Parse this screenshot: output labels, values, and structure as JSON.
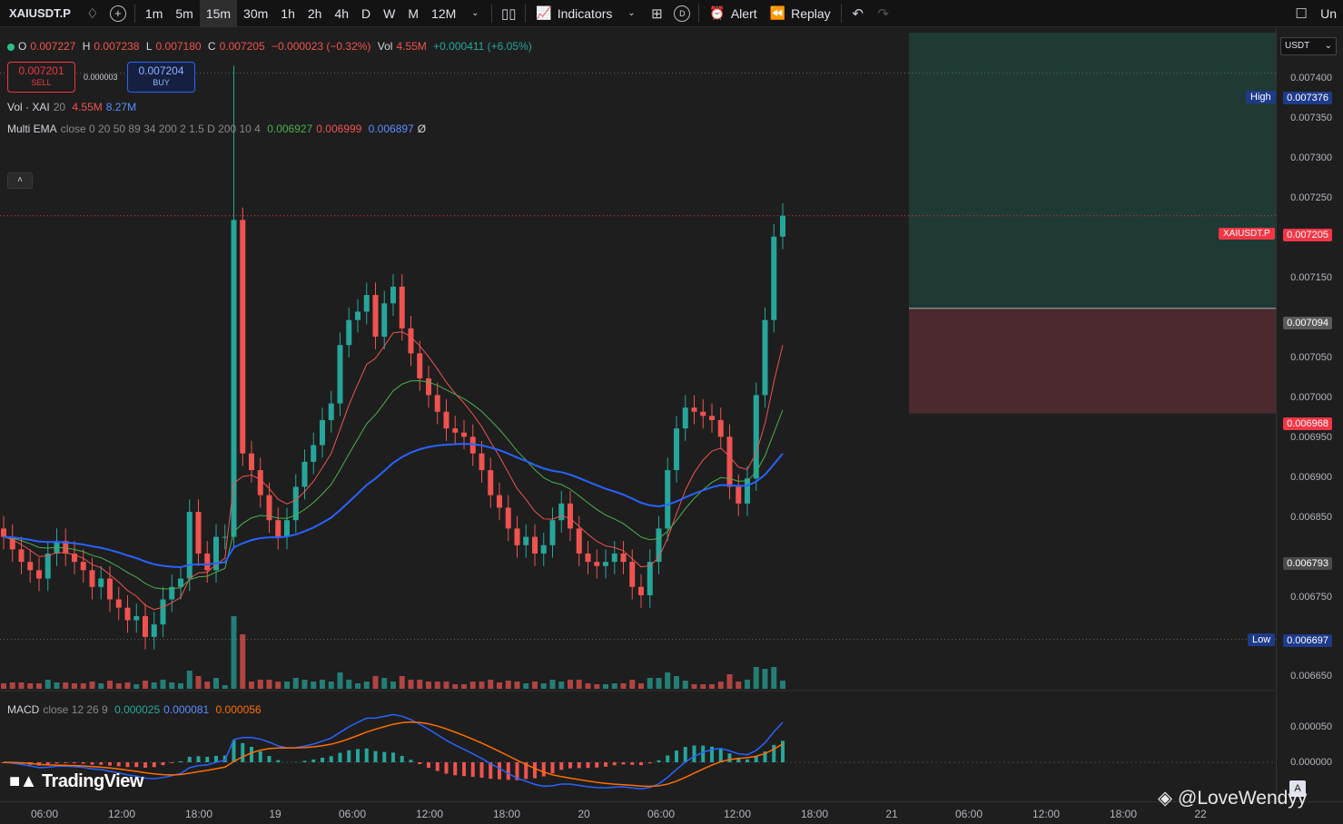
{
  "toolbar": {
    "symbol": "XAIUSDT.P",
    "timeframes": [
      "1m",
      "5m",
      "15m",
      "30m",
      "1h",
      "2h",
      "4h",
      "D",
      "W",
      "M",
      "12M"
    ],
    "active_timeframe": "15m",
    "indicators_label": "Indicators",
    "alert_label": "Alert",
    "replay_label": "Replay",
    "d_badge": "D",
    "right_label": "Un"
  },
  "legend": {
    "o_label": "O",
    "o_value": "0.007227",
    "h_label": "H",
    "h_value": "0.007238",
    "l_label": "L",
    "l_value": "0.007180",
    "c_label": "C",
    "c_value": "0.007205",
    "change": "−0.000023 (−0.32%)",
    "vol_label": "Vol",
    "vol_value": "4.55M",
    "vol_change": "+0.000411 (+6.05%)"
  },
  "trade": {
    "sell_price": "0.007201",
    "sell_label": "SELL",
    "spread": "0.000003",
    "buy_price": "0.007204",
    "buy_label": "BUY"
  },
  "indicators": {
    "vol_title": "Vol · XAI",
    "vol_len": "20",
    "vol_a": "4.55M",
    "vol_b": "8.27M",
    "ema_title": "Multi EMA",
    "ema_params": "close 0 20 50 89 34 200 2 1.5 D 200 10 4",
    "ema_v1": "0.006927",
    "ema_v2": "0.006999",
    "ema_v3": "0.006897",
    "ema_v4": "Ø",
    "macd_title": "MACD",
    "macd_params": "close 12 26 9",
    "macd_v1": "0.000025",
    "macd_v2": "0.000081",
    "macd_v3": "0.000056"
  },
  "price_axis": {
    "unit": "USDT",
    "ticks": [
      "0.007400",
      "0.007350",
      "0.007300",
      "0.007250",
      "0.007150",
      "0.007050",
      "0.007000",
      "0.006950",
      "0.006900",
      "0.006850",
      "0.006750",
      "0.006650"
    ],
    "high_label": "High",
    "high_value": "0.007376",
    "current_symbol": "XAIUSDT.P",
    "current_value": "0.007205",
    "target_value": "0.007094",
    "stop_value": "0.006968",
    "mid_value": "0.006793",
    "low_label": "Low",
    "low_value": "0.006697",
    "macd_ticks": [
      "0.000050",
      "0.000000"
    ]
  },
  "time_axis": [
    "06:00",
    "12:00",
    "18:00",
    "19",
    "06:00",
    "12:00",
    "18:00",
    "20",
    "06:00",
    "12:00",
    "18:00",
    "21",
    "06:00",
    "12:00",
    "18:00",
    "22"
  ],
  "branding": {
    "logo": "TradingView",
    "watermark": "@LoveWendyy",
    "a_button": "A"
  },
  "colors": {
    "up": "#26a69a",
    "down": "#ef5350",
    "ema_fast": "#ef5350",
    "ema_mid": "#4caf50",
    "ema_slow": "#2962ff",
    "macd": "#2962ff",
    "signal": "#ff6d00",
    "profit_zone": "#1f3a35",
    "loss_zone": "#4a2a2e"
  },
  "chart_data": {
    "type": "candlestick",
    "symbol": "XAIUSDT.P",
    "ylim": [
      0.00664,
      0.00743
    ],
    "last_close": 0.007205,
    "session_high": 0.007376,
    "session_low": 0.006697,
    "closes": [
      0.00682,
      0.006805,
      0.00679,
      0.00678,
      0.00677,
      0.0068,
      0.006815,
      0.0068,
      0.00679,
      0.00678,
      0.00676,
      0.00677,
      0.006745,
      0.006735,
      0.00672,
      0.006725,
      0.0067,
      0.006715,
      0.006745,
      0.00676,
      0.00677,
      0.00685,
      0.0068,
      0.00678,
      0.00682,
      0.00682,
      0.0072,
      0.00692,
      0.0069,
      0.00687,
      0.00684,
      0.00682,
      0.00684,
      0.00688,
      0.00691,
      0.00693,
      0.00696,
      0.00698,
      0.00705,
      0.00708,
      0.00709,
      0.00711,
      0.00706,
      0.0071,
      0.00712,
      0.00707,
      0.00704,
      0.00701,
      0.00699,
      0.00697,
      0.00695,
      0.006945,
      0.00694,
      0.00692,
      0.0069,
      0.00687,
      0.006855,
      0.00683,
      0.00681,
      0.00682,
      0.0068,
      0.00681,
      0.00684,
      0.00686,
      0.00683,
      0.0068,
      0.00679,
      0.006785,
      0.00679,
      0.0068,
      0.00679,
      0.00676,
      0.00675,
      0.00679,
      0.00683,
      0.0069,
      0.00695,
      0.006975,
      0.00697,
      0.006965,
      0.00696,
      0.00694,
      0.00688,
      0.00686,
      0.00689,
      0.00699,
      0.00708,
      0.00718,
      0.007205
    ],
    "volume_peak_time": "19",
    "macd_line_peak": 8.1e-05,
    "series": [
      {
        "name": "EMA 20",
        "last": 0.006999
      },
      {
        "name": "EMA 50",
        "last": 0.006927
      },
      {
        "name": "EMA 200",
        "last": 0.006897
      }
    ]
  }
}
